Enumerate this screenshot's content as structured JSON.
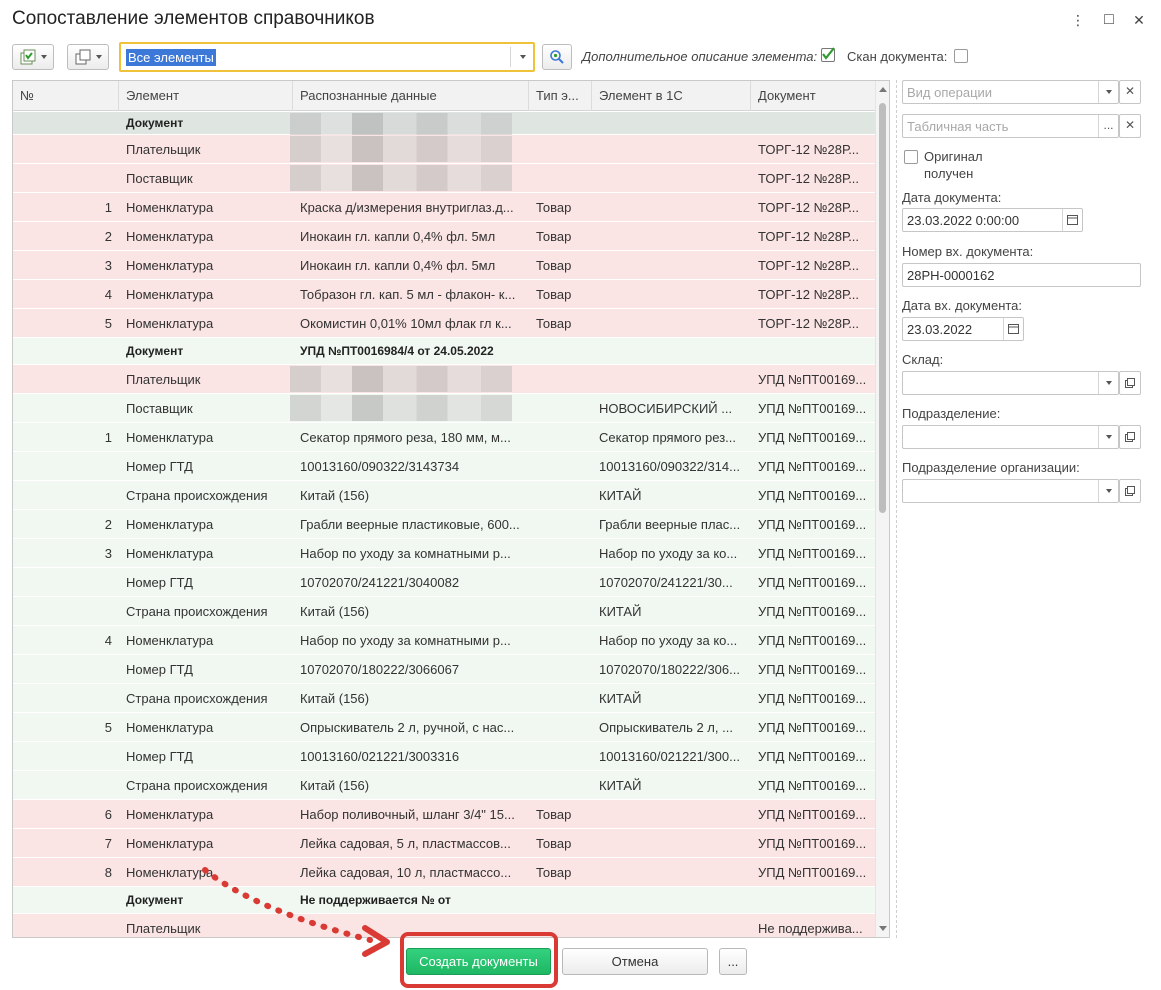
{
  "window": {
    "title": "Сопоставление элементов справочников",
    "more_icon": "⋮",
    "maximize_icon": "□",
    "close_icon": "✕"
  },
  "toolbar": {
    "filter_value": "Все элементы",
    "extra_desc_label": "Дополнительное описание элемента:",
    "extra_desc_checked": true,
    "scan_label": "Скан документа:",
    "scan_checked": false
  },
  "table": {
    "columns": [
      "№",
      "Элемент",
      "Распознанные данные",
      "Тип э...",
      "Элемент в 1С",
      "Документ"
    ],
    "rows": [
      {
        "style": "sel",
        "bold": true,
        "num": "",
        "element": "Документ",
        "data": "",
        "type": "",
        "elem1c": "",
        "doc": "",
        "blur": true
      },
      {
        "style": "pink",
        "num": "",
        "element": "Плательщик",
        "data": "",
        "type": "",
        "elem1c": "",
        "doc": "ТОРГ-12 №28Р...",
        "blur": true
      },
      {
        "style": "pink",
        "num": "",
        "element": "Поставщик",
        "data": "",
        "type": "",
        "elem1c": "",
        "doc": "ТОРГ-12 №28Р...",
        "blur": true
      },
      {
        "style": "pink",
        "num": "1",
        "element": "Номенклатура",
        "data": "Краска д/измерения внутриглаз.д...",
        "type": "Товар",
        "elem1c": "",
        "doc": "ТОРГ-12 №28Р..."
      },
      {
        "style": "pink",
        "num": "2",
        "element": "Номенклатура",
        "data": "Инокаин гл. капли 0,4% фл. 5мл",
        "type": "Товар",
        "elem1c": "",
        "doc": "ТОРГ-12 №28Р..."
      },
      {
        "style": "pink",
        "num": "3",
        "element": "Номенклатура",
        "data": "Инокаин гл. капли 0,4% фл. 5мл",
        "type": "Товар",
        "elem1c": "",
        "doc": "ТОРГ-12 №28Р..."
      },
      {
        "style": "pink",
        "num": "4",
        "element": "Номенклатура",
        "data": "Тобразон гл. кап. 5 мл - флакон- к...",
        "type": "Товар",
        "elem1c": "",
        "doc": "ТОРГ-12 №28Р..."
      },
      {
        "style": "pink",
        "num": "5",
        "element": "Номенклатура",
        "data": "Окомистин 0,01% 10мл флак гл к...",
        "type": "Товар",
        "elem1c": "",
        "doc": "ТОРГ-12 №28Р..."
      },
      {
        "style": "green",
        "bold": true,
        "num": "",
        "element": "Документ",
        "data": "УПД №ПТ0016984/4 от 24.05.2022",
        "type": "",
        "elem1c": "",
        "doc": ""
      },
      {
        "style": "pink",
        "num": "",
        "element": "Плательщик",
        "data": "",
        "type": "",
        "elem1c": "",
        "doc": "УПД №ПТ00169...",
        "blur": true
      },
      {
        "style": "green",
        "num": "",
        "element": "Поставщик",
        "data": "",
        "type": "",
        "elem1c": "НОВОСИБИРСКИЙ ...",
        "doc": "УПД №ПТ00169...",
        "blur": true
      },
      {
        "style": "green",
        "num": "1",
        "element": "Номенклатура",
        "data": "Секатор прямого реза, 180 мм, м...",
        "type": "",
        "elem1c": "Секатор прямого рез...",
        "doc": "УПД №ПТ00169..."
      },
      {
        "style": "green",
        "num": "",
        "element": "Номер ГТД",
        "data": "10013160/090322/3143734",
        "type": "",
        "elem1c": "10013160/090322/314...",
        "doc": "УПД №ПТ00169..."
      },
      {
        "style": "green",
        "num": "",
        "element": "Страна происхождения",
        "data": "Китай (156)",
        "type": "",
        "elem1c": "КИТАЙ",
        "doc": "УПД №ПТ00169..."
      },
      {
        "style": "green",
        "num": "2",
        "element": "Номенклатура",
        "data": "Грабли веерные пластиковые, 600...",
        "type": "",
        "elem1c": "Грабли веерные плас...",
        "doc": "УПД №ПТ00169..."
      },
      {
        "style": "green",
        "num": "3",
        "element": "Номенклатура",
        "data": "Набор по уходу за комнатными р...",
        "type": "",
        "elem1c": "Набор по уходу за ко...",
        "doc": "УПД №ПТ00169..."
      },
      {
        "style": "green",
        "num": "",
        "element": "Номер ГТД",
        "data": "10702070/241221/3040082",
        "type": "",
        "elem1c": "10702070/241221/30...",
        "doc": "УПД №ПТ00169..."
      },
      {
        "style": "green",
        "num": "",
        "element": "Страна происхождения",
        "data": "Китай (156)",
        "type": "",
        "elem1c": "КИТАЙ",
        "doc": "УПД №ПТ00169..."
      },
      {
        "style": "green",
        "num": "4",
        "element": "Номенклатура",
        "data": "Набор по уходу за комнатными р...",
        "type": "",
        "elem1c": "Набор по уходу за ко...",
        "doc": "УПД №ПТ00169..."
      },
      {
        "style": "green",
        "num": "",
        "element": "Номер ГТД",
        "data": "10702070/180222/3066067",
        "type": "",
        "elem1c": "10702070/180222/306...",
        "doc": "УПД №ПТ00169..."
      },
      {
        "style": "green",
        "num": "",
        "element": "Страна происхождения",
        "data": "Китай (156)",
        "type": "",
        "elem1c": "КИТАЙ",
        "doc": "УПД №ПТ00169..."
      },
      {
        "style": "green",
        "num": "5",
        "element": "Номенклатура",
        "data": "Опрыскиватель 2 л, ручной, с нас...",
        "type": "",
        "elem1c": "Опрыскиватель 2 л, ...",
        "doc": "УПД №ПТ00169..."
      },
      {
        "style": "green",
        "num": "",
        "element": "Номер ГТД",
        "data": "10013160/021221/3003316",
        "type": "",
        "elem1c": "10013160/021221/300...",
        "doc": "УПД №ПТ00169..."
      },
      {
        "style": "green",
        "num": "",
        "element": "Страна происхождения",
        "data": "Китай (156)",
        "type": "",
        "elem1c": "КИТАЙ",
        "doc": "УПД №ПТ00169..."
      },
      {
        "style": "pink",
        "num": "6",
        "element": "Номенклатура",
        "data": "Набор поливочный, шланг 3/4\" 15...",
        "type": "Товар",
        "elem1c": "",
        "doc": "УПД №ПТ00169..."
      },
      {
        "style": "pink",
        "num": "7",
        "element": "Номенклатура",
        "data": "Лейка садовая, 5 л, пластмассов...",
        "type": "Товар",
        "elem1c": "",
        "doc": "УПД №ПТ00169..."
      },
      {
        "style": "pink",
        "num": "8",
        "element": "Номенклатура",
        "data": "Лейка садовая, 10 л, пластмассо...",
        "type": "Товар",
        "elem1c": "",
        "doc": "УПД №ПТ00169..."
      },
      {
        "style": "green",
        "bold": true,
        "num": "",
        "element": "Документ",
        "data": "Не поддерживается № от",
        "type": "",
        "elem1c": "",
        "doc": ""
      },
      {
        "style": "pink",
        "num": "",
        "element": "Плательщик",
        "data": "",
        "type": "",
        "elem1c": "",
        "doc": "Не поддержива..."
      }
    ]
  },
  "panel": {
    "operation_placeholder": "Вид операции",
    "tabular_placeholder": "Табличная часть",
    "original_label": "Оригинал\nполучен",
    "doc_date_label": "Дата документа:",
    "doc_date_value": "23.03.2022  0:00:00",
    "in_number_label": "Номер вх. документа:",
    "in_number_value": "28РН-0000162",
    "in_date_label": "Дата вх. документа:",
    "in_date_value": "23.03.2022",
    "warehouse_label": "Склад:",
    "department_label": "Подразделение:",
    "org_department_label": "Подразделение организации:"
  },
  "footer": {
    "create_label": "Создать документы",
    "cancel_label": "Отмена",
    "more_label": "..."
  },
  "colors": {
    "accent_yellow": "#f0c23a",
    "row_pink": "#fbe4e4",
    "row_green": "#f1f8f1",
    "primary_green": "#1fb865",
    "annotation_red": "#d93a33"
  }
}
